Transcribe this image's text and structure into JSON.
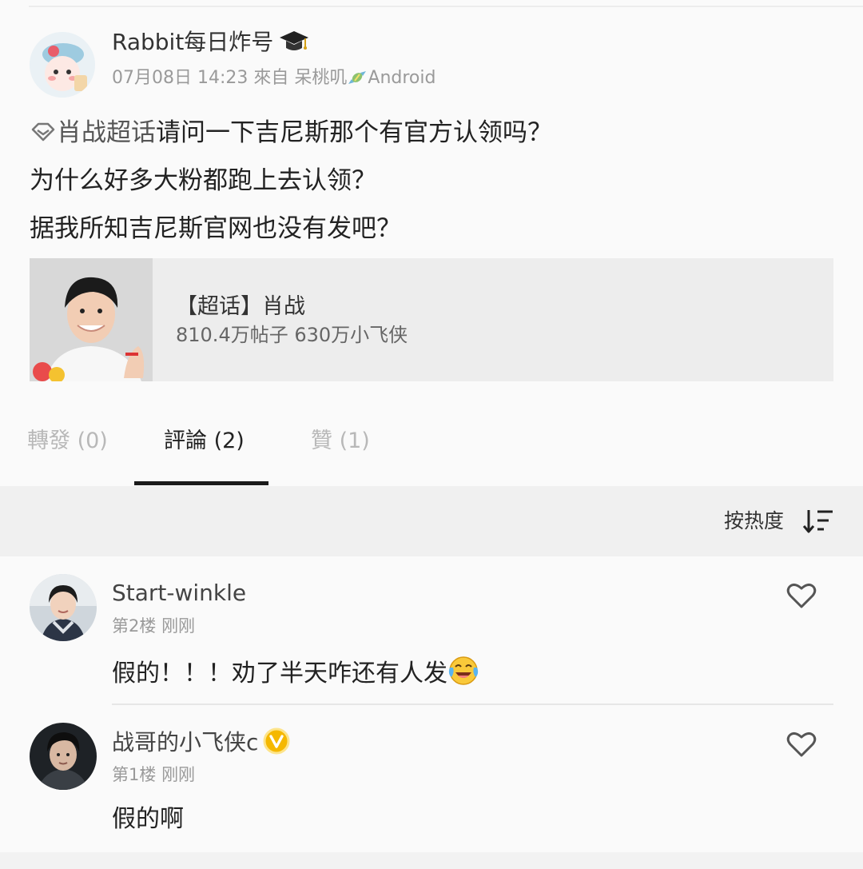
{
  "post": {
    "author": "Rabbit每日炸号",
    "timestamp": "07月08日 14:23",
    "source_prefix": "來自 呆桃叽",
    "source_suffix": "Android",
    "topic_link": "肖战超话",
    "lines": [
      "请问一下吉尼斯那个有官方认领吗？",
      "为什么好多大粉都跑上去认领？",
      "据我所知吉尼斯官网也没有发吧？"
    ],
    "icons": {
      "author_badge": "graduation-cap-icon",
      "source": "candy-icon",
      "topic": "diamond-icon"
    }
  },
  "topic_card": {
    "title": "【超话】肖战",
    "stats": "810.4万帖子 630万小飞侠"
  },
  "tabs": [
    {
      "label": "轉發 (0)",
      "active": false
    },
    {
      "label": "評論 (2)",
      "active": true
    },
    {
      "label": "贊 (1)",
      "active": false
    }
  ],
  "sort": {
    "label": "按热度",
    "icon": "sort-descending-icon"
  },
  "comments": [
    {
      "user": "Start-winkle",
      "floor": "第2楼",
      "time": "刚刚",
      "text": "假的！！！劝了半天咋还有人发",
      "emoji": "laughing-crying-emoji",
      "verified": false
    },
    {
      "user": "战哥的小飞侠c",
      "floor": "第1楼",
      "time": "刚刚",
      "text": "假的啊",
      "verified": true,
      "badge_icon": "vip-v-badge-icon"
    }
  ],
  "colors": {
    "background": "#f2f2f2",
    "card": "#fafafa",
    "text": "#222222",
    "muted": "#9a9a9a",
    "vip_badge": "#f5b800",
    "tab_indicator": "#1a1a1a"
  }
}
